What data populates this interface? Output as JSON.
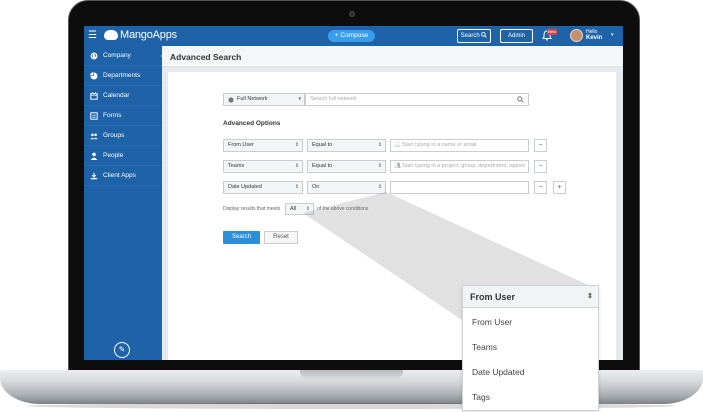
{
  "topbar": {
    "logo": "MangoApps",
    "compose": "+ Compose",
    "search_button": "Search",
    "admin_button": "Admin",
    "notification_badge": "New",
    "greeting": "Hello",
    "user_name": "Kevin"
  },
  "sidebar": {
    "items": [
      {
        "label": "Company",
        "icon": "globe-icon"
      },
      {
        "label": "Departments",
        "icon": "pie-icon"
      },
      {
        "label": "Calendar",
        "icon": "calendar-icon"
      },
      {
        "label": "Forms",
        "icon": "forms-icon"
      },
      {
        "label": "Groups",
        "icon": "groups-icon"
      },
      {
        "label": "People",
        "icon": "person-icon"
      },
      {
        "label": "Client Apps",
        "icon": "download-icon"
      }
    ],
    "edit_icon": "pencil-icon"
  },
  "page": {
    "title": "Advanced Search",
    "scope_select": "Full Network",
    "search_placeholder": "Search full network",
    "advanced_options_label": "Advanced Options",
    "rows": [
      {
        "field": "From User",
        "operator": "Equal to",
        "placeholder": "Start typing in a name or email"
      },
      {
        "field": "Teams",
        "operator": "Equal to",
        "placeholder": "Start typing in a project, group, department, opport"
      },
      {
        "field": "Date Updated",
        "operator": "On",
        "placeholder": ""
      }
    ],
    "display_prefix": "Display results that meets",
    "match_select": "All",
    "display_suffix": "of the above conditions",
    "search_button": "Search",
    "reset_button": "Reset"
  },
  "dropdown": {
    "selected": "From User",
    "options": [
      "From User",
      "Teams",
      "Date Updated",
      "Tags"
    ]
  },
  "colors": {
    "brand_blue": "#1e62a8",
    "compose_blue": "#3a9eea",
    "button_blue": "#2b8fd9"
  }
}
